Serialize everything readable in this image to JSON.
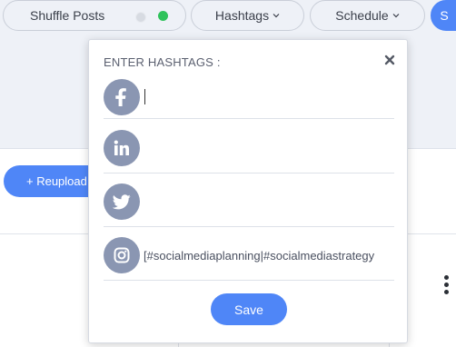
{
  "toolbar": {
    "shuffle_label": "Shuffle Posts",
    "hashtags_label": "Hashtags",
    "schedule_label": "Schedule",
    "next_label": "S"
  },
  "content": {
    "reupload_label": "+ Reupload"
  },
  "popover": {
    "title": "ENTER HASHTAGS :",
    "close_icon": "close-icon",
    "rows": [
      {
        "network": "facebook",
        "icon": "facebook-icon",
        "value": "",
        "placeholder": ""
      },
      {
        "network": "linkedin",
        "icon": "linkedin-icon",
        "value": "",
        "placeholder": ""
      },
      {
        "network": "twitter",
        "icon": "twitter-icon",
        "value": "",
        "placeholder": ""
      },
      {
        "network": "instagram",
        "icon": "instagram-icon",
        "value": "[#socialmediaplanning|#socialmediastrategy",
        "placeholder": ""
      }
    ],
    "save_label": "Save"
  },
  "colors": {
    "accent": "#4f86f7",
    "social_icon_bg": "#8a96b2",
    "toggle_on": "#2fc25b",
    "toolbar_bg": "#eef1f7"
  }
}
